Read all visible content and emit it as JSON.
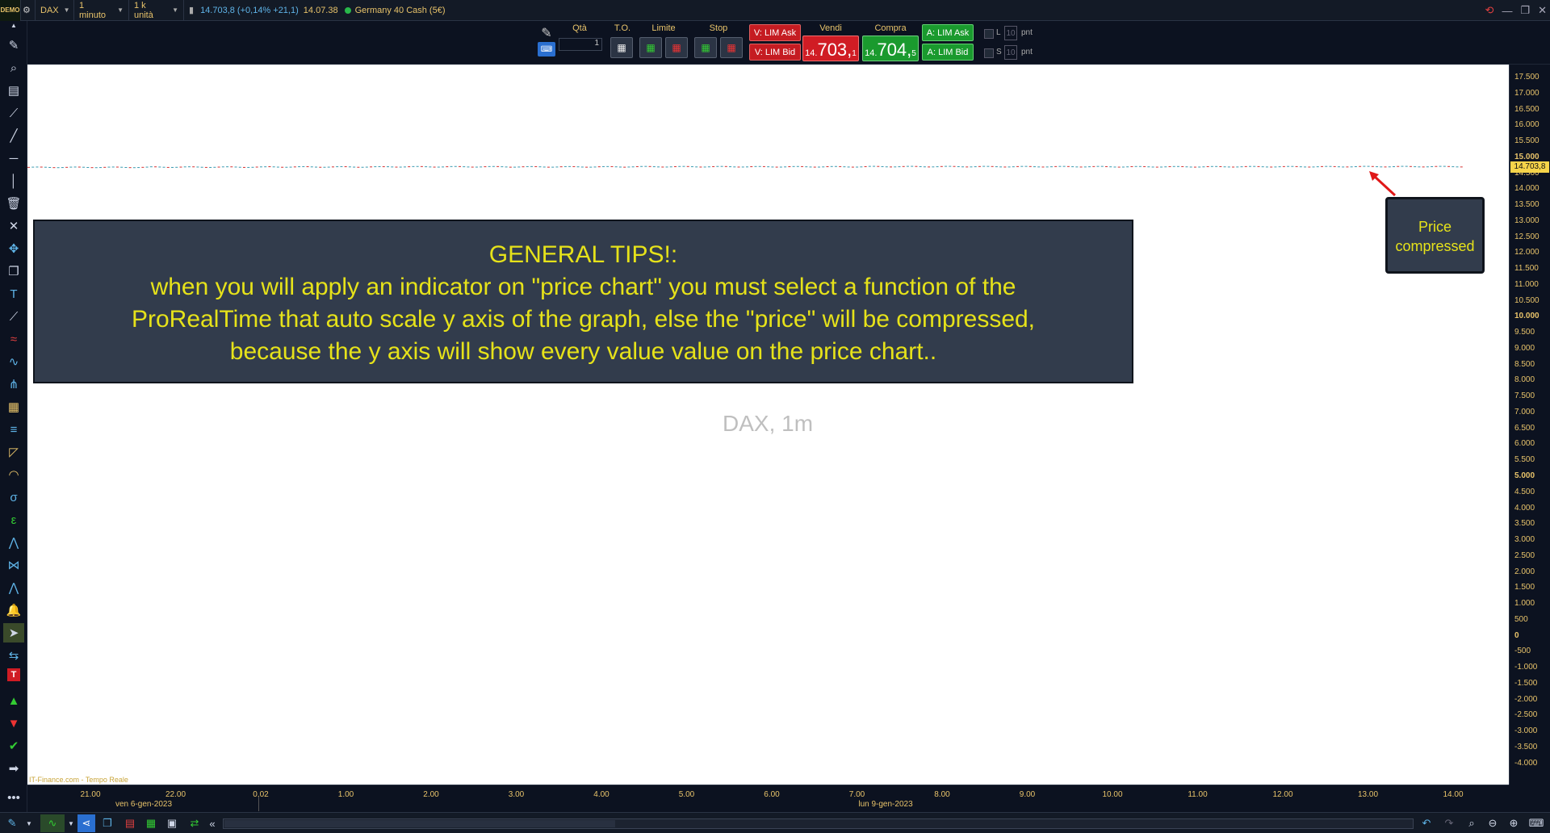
{
  "titlebar": {
    "logo": "DEMO",
    "instrument": "DAX",
    "timeframe": "1 minuto",
    "units": "1 k unità",
    "quote": "14.703,8 (+0,14% +21,1)",
    "time": "14.07.38",
    "instrument_name": "Germany 40 Cash (5€)"
  },
  "orderbar": {
    "qty_label": "Qtà",
    "qty_value": "1",
    "to_label": "T.O.",
    "limit_label": "Limite",
    "stop_label": "Stop",
    "sell_label": "Vendi",
    "buy_label": "Compra",
    "v_lim_ask": "V: LIM Ask",
    "v_lim_bid": "V: LIM Bid",
    "a_lim_ask": "A: LIM Ask",
    "a_lim_bid": "A: LIM Bid",
    "sell_price_prefix": "14.",
    "sell_price_main": "703,",
    "sell_price_sup": "1",
    "buy_price_prefix": "14.",
    "buy_price_main": "704,",
    "buy_price_sup": "5",
    "l_label": "L",
    "s_label": "S",
    "pnt_l": "10",
    "pnt_s": "10",
    "pnt_unit": "pnt"
  },
  "chart": {
    "watermark": "DAX, 1m",
    "credit": "IT-Finance.com - Tempo Reale",
    "tip_title": "GENERAL TIPS!:",
    "tip_line1": "when you will apply an indicator on \"price chart\" you must select a function of the",
    "tip_line2": "ProRealTime that auto scale y axis of the graph, else the \"price\" will be compressed,",
    "tip_line3": "because the y axis will show every value value on the price chart..",
    "note_line1": "Price",
    "note_line2": "compressed",
    "last_price": "14.703,8"
  },
  "colors": {
    "tip_text": "#e6e21a",
    "box_bg": "#323c4c",
    "axis_text": "#e8c36a",
    "arrow": "#e01818",
    "price_tag": "#f6d44a"
  },
  "chart_data": {
    "type": "line",
    "series": [
      {
        "values": [
          14683,
          14690,
          14695,
          14700,
          14698,
          14702,
          14700,
          14705,
          14703,
          14700,
          14702,
          14705,
          14703.8
        ]
      }
    ],
    "x_labels": [
      "21.00",
      "22.00",
      "0.02",
      "1.00",
      "2.00",
      "3.00",
      "4.00",
      "5.00",
      "6.00",
      "7.00",
      "8.00",
      "9.00",
      "10.00",
      "11.00",
      "12.00",
      "13.00",
      "14.00"
    ],
    "date_labels": [
      "ven 6-gen-2023",
      "lun 9-gen-2023"
    ],
    "y_labels": [
      "17.500",
      "17.000",
      "16.500",
      "16.000",
      "15.500",
      "15.000",
      "14.500",
      "14.000",
      "13.500",
      "13.000",
      "12.500",
      "12.000",
      "11.500",
      "11.000",
      "10.500",
      "10.000",
      "9.500",
      "9.000",
      "8.500",
      "8.000",
      "7.500",
      "7.000",
      "6.500",
      "6.000",
      "5.500",
      "5.000",
      "4.500",
      "4.000",
      "3.500",
      "3.000",
      "2.500",
      "2.000",
      "1.500",
      "1.000",
      "500",
      "0",
      "-500",
      "-1.000",
      "-1.500",
      "-2.000",
      "-2.500",
      "-3.000",
      "-3.500",
      "-4.000"
    ],
    "ylim": [
      -4000,
      17500
    ]
  }
}
